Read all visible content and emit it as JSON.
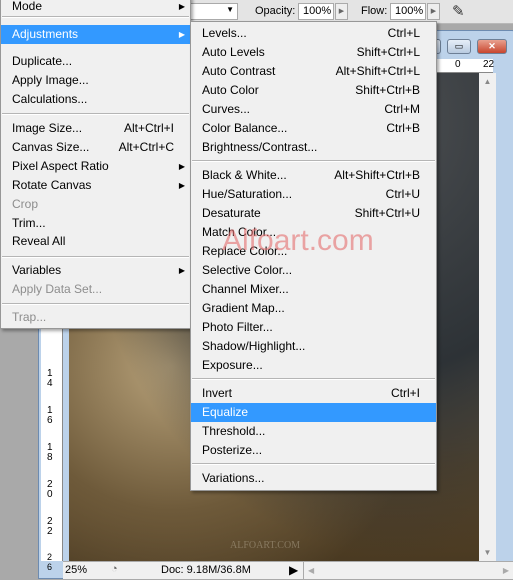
{
  "toolbar": {
    "opacity_label": "Opacity:",
    "opacity_value": "100%",
    "flow_label": "Flow:",
    "flow_value": "100%",
    "airbrush_icon": "airbrush-icon"
  },
  "window": {
    "ruler_top": [
      "0",
      "22"
    ],
    "ruler_left": [
      "1\n4",
      "1\n6",
      "1\n8",
      "2\n0",
      "2\n2",
      "2\n4",
      "2\n6"
    ],
    "watermark": "Alfoart.com",
    "canvas_watermark": "ALFOART.COM"
  },
  "status": {
    "zoom": "25%",
    "doc": "Doc: 9.18M/36.8M"
  },
  "image_menu": {
    "items": [
      {
        "label": "Mode",
        "submenu": true
      },
      {
        "label": "Adjustments",
        "submenu": true,
        "highlighted": true
      },
      {
        "label": "Duplicate..."
      },
      {
        "label": "Apply Image..."
      },
      {
        "label": "Calculations..."
      },
      {
        "label": "Image Size...",
        "shortcut": "Alt+Ctrl+I"
      },
      {
        "label": "Canvas Size...",
        "shortcut": "Alt+Ctrl+C"
      },
      {
        "label": "Pixel Aspect Ratio",
        "submenu": true
      },
      {
        "label": "Rotate Canvas",
        "submenu": true
      },
      {
        "label": "Crop",
        "disabled": true
      },
      {
        "label": "Trim..."
      },
      {
        "label": "Reveal All"
      },
      {
        "label": "Variables",
        "submenu": true
      },
      {
        "label": "Apply Data Set...",
        "disabled": true
      },
      {
        "label": "Trap...",
        "disabled": true
      }
    ]
  },
  "adjustments_menu": {
    "items": [
      {
        "label": "Levels...",
        "shortcut": "Ctrl+L"
      },
      {
        "label": "Auto Levels",
        "shortcut": "Shift+Ctrl+L"
      },
      {
        "label": "Auto Contrast",
        "shortcut": "Alt+Shift+Ctrl+L"
      },
      {
        "label": "Auto Color",
        "shortcut": "Shift+Ctrl+B"
      },
      {
        "label": "Curves...",
        "shortcut": "Ctrl+M"
      },
      {
        "label": "Color Balance...",
        "shortcut": "Ctrl+B"
      },
      {
        "label": "Brightness/Contrast..."
      },
      {
        "label": "Black & White...",
        "shortcut": "Alt+Shift+Ctrl+B"
      },
      {
        "label": "Hue/Saturation...",
        "shortcut": "Ctrl+U"
      },
      {
        "label": "Desaturate",
        "shortcut": "Shift+Ctrl+U"
      },
      {
        "label": "Match Color..."
      },
      {
        "label": "Replace Color..."
      },
      {
        "label": "Selective Color..."
      },
      {
        "label": "Channel Mixer..."
      },
      {
        "label": "Gradient Map..."
      },
      {
        "label": "Photo Filter..."
      },
      {
        "label": "Shadow/Highlight..."
      },
      {
        "label": "Exposure..."
      },
      {
        "label": "Invert",
        "shortcut": "Ctrl+I"
      },
      {
        "label": "Equalize",
        "highlighted": true
      },
      {
        "label": "Threshold..."
      },
      {
        "label": "Posterize..."
      },
      {
        "label": "Variations..."
      }
    ]
  },
  "colors": {
    "highlight": "#3399ff",
    "menu_bg": "#f0f0f0",
    "close_button": "#d9553f"
  }
}
